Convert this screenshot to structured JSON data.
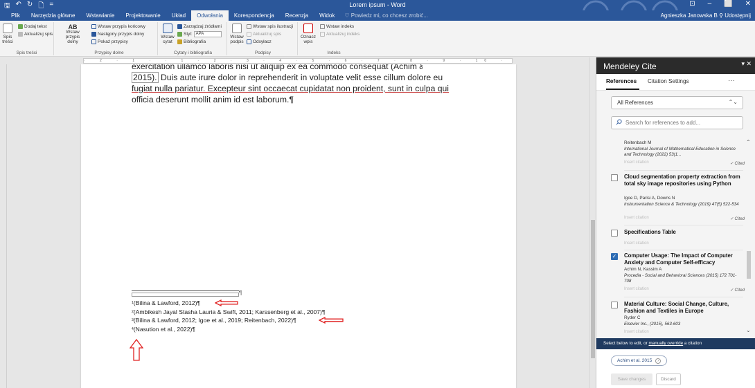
{
  "titlebar": {
    "qat_save": "🖫",
    "qat_undo": "↶",
    "qat_redo": "↻",
    "qat_new": "🗋",
    "qat_more": "=",
    "title": "Lorem ipsum - Word",
    "win_ribbon": "⊡",
    "win_min": "–",
    "win_max": "⬜",
    "win_close": "✕"
  },
  "tabs": {
    "items": [
      "Plik",
      "Narzędzia główne",
      "Wstawianie",
      "Projektowanie",
      "Układ",
      "Odwołania",
      "Korespondencja",
      "Recenzja",
      "Widok"
    ],
    "active": "Odwołania",
    "tell_me": "Powiedz mi, co chcesz zrobić...",
    "user": "Agnieszka Janowska B",
    "share": "Udostępnij"
  },
  "ribbon": {
    "toc": {
      "big": "Spis treści",
      "add_text": "Dodaj tekst",
      "update": "Aktualizuj spis",
      "group": "Spis treści"
    },
    "footnotes": {
      "big": "Wstaw przypis dolny",
      "endnote": "Wstaw przypis końcowy",
      "next": "Następny przypis dolny",
      "show": "Pokaż przypisy",
      "group": "Przypisy dolne",
      "ab": "AB"
    },
    "citations": {
      "big": "Wstaw cytat",
      "manage": "Zarządzaj źródłami",
      "style_label": "Styl:",
      "style_value": "APA",
      "biblio": "Bibliografia",
      "group": "Cytaty i bibliografia"
    },
    "captions": {
      "big": "Wstaw podpis",
      "tof": "Wstaw spis ilustracji",
      "update": "Aktualizuj spis",
      "crossref": "Odsyłacz",
      "group": "Podpisy"
    },
    "index": {
      "big": "Oznacz wpis",
      "insert": "Wstaw indeks",
      "update": "Aktualizuj indeks",
      "group": "Indeks"
    }
  },
  "ruler": {
    "ticks": "· 2 · 1 · · 1 · 2 · 3 · 4 · 5 · 6 · 7 · 8 · 9 · 10 · 11 · 12 · 13 · 14 · 15 · · 17 · 18"
  },
  "document": {
    "line0": "exercitation ullamco laboris nisi ut aliquip ex ea commodo consequat (Achim & Kassim,",
    "line1_a": "2015).",
    "line1_b": " Duis aute irure dolor in reprehenderit in voluptate velit esse cillum dolore eu",
    "line2": "fugiat nulla pariatur. Excepteur sint occaecat cupidatat non proident, sunt in culpa qui",
    "line3": "officia deserunt mollit anim id est laborum.¶",
    "sep_pilcrow": "¶",
    "footnotes": [
      {
        "num": "1",
        "text": "(Bilina & Lawford, 2012)¶"
      },
      {
        "num": "2",
        "text": "(Ambikesh Jayal Stasha Lauria & Swift, 2011; Karssenberg et al., 2007)¶"
      },
      {
        "num": "3",
        "text": "(Bilina & Lawford, 2012; Igoe et al., 2019; Reitenbach, 2022)¶"
      },
      {
        "num": "4",
        "text": "(Nasution et al., 2022)¶"
      }
    ]
  },
  "panel": {
    "title": "Mendeley Cite",
    "controls": "▾ ✕",
    "tab_references": "References",
    "tab_settings": "Citation Settings",
    "more": "···",
    "dropdown": "All References",
    "search_placeholder": "Search for references to add...",
    "items": [
      {
        "title": "",
        "author": "Reitenbach M",
        "journal": "International Journal of Mathematical Education in Science and Technology (2022) 53(1...",
        "insert": "Insert citation",
        "cited": "✓ Cited",
        "checked": false
      },
      {
        "title": "Cloud segmentation property extraction from total sky image repositories using Python",
        "author": "Igoe D, Parisi A, Downs N",
        "journal": "Instrumentation Science & Technology (2019) 47(5) 522-534",
        "insert": "Insert citation",
        "cited": "✓ Cited",
        "checked": false
      },
      {
        "title": "Specifications Table",
        "author": "",
        "journal": "",
        "insert": "Insert citation",
        "cited": "",
        "checked": false
      },
      {
        "title": "Computer Usage: The Impact of Computer Anxiety and Computer Self-efficacy",
        "author": "Achim N, Kassim A",
        "journal": "Procedia - Social and Behavioral Sciences (2015) 172 701-708",
        "insert": "Insert citation",
        "cited": "✓ Cited",
        "checked": true
      },
      {
        "title": "Material Culture: Social Change, Culture, Fashion and Textiles in Europe",
        "author": "Ryder C",
        "journal": "Elsevier Inc., (2015), 563-603",
        "insert": "Insert citation",
        "cited": "",
        "checked": false
      }
    ],
    "edit_bar_prefix": "Select below to edit, or ",
    "edit_bar_link": "manually override",
    "edit_bar_suffix": " a citation",
    "chip": "Achim et al. 2015",
    "save": "Save changes",
    "discard": "Discard"
  },
  "colors": {
    "word_blue": "#2b579a",
    "annotation_red": "#e02020",
    "mendeley_dark": "#2b2b2b",
    "editbar_navy": "#1f3a60",
    "check_blue": "#2e6db4"
  }
}
